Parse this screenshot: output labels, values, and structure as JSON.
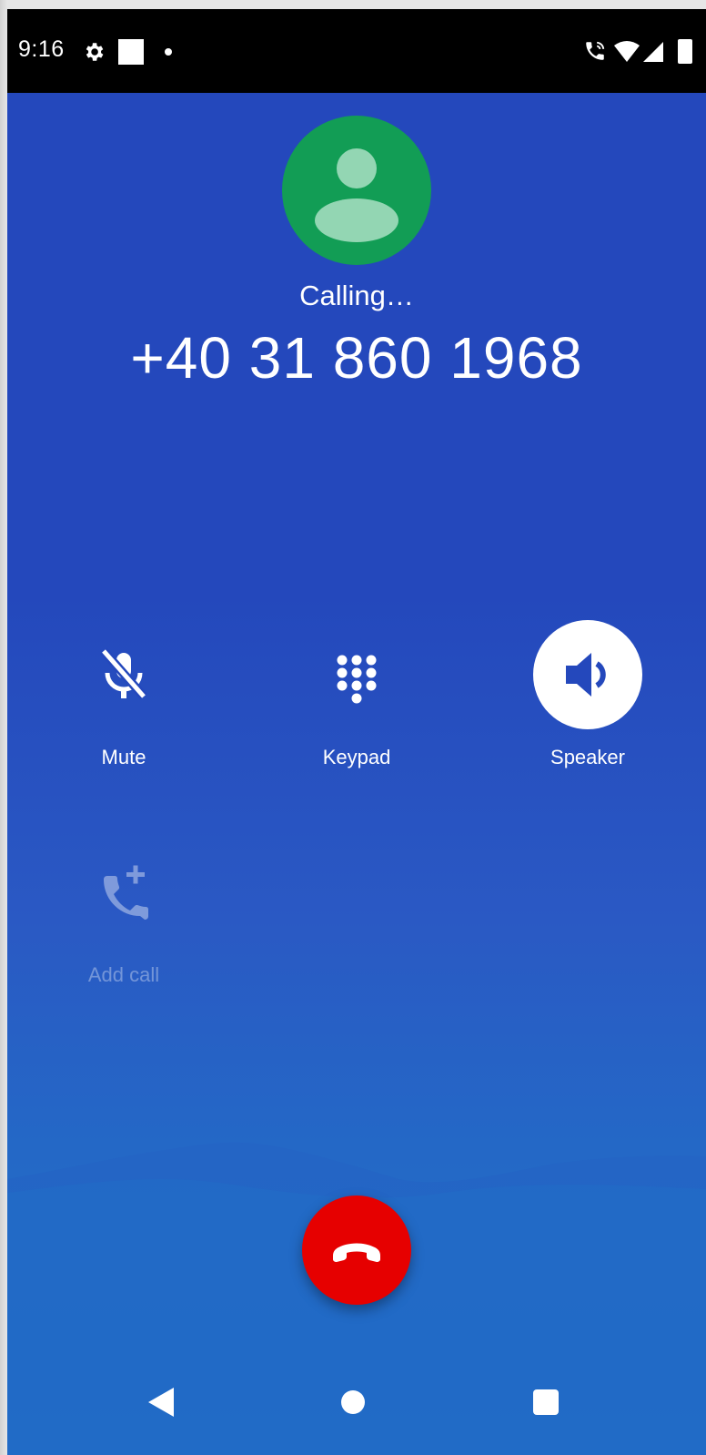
{
  "status_bar": {
    "time": "9:16",
    "icons": [
      "settings-icon",
      "square-notification-icon",
      "dot-icon",
      "wifi-call-icon",
      "wifi-icon",
      "signal-icon",
      "battery-icon"
    ]
  },
  "call": {
    "status": "Calling…",
    "number": "+40 31 860 1968",
    "avatar_color": "#129d55"
  },
  "controls": [
    {
      "id": "mute",
      "label": "Mute",
      "icon": "mic-off-icon",
      "active": false,
      "enabled": true
    },
    {
      "id": "keypad",
      "label": "Keypad",
      "icon": "dialpad-icon",
      "active": false,
      "enabled": true
    },
    {
      "id": "speaker",
      "label": "Speaker",
      "icon": "speaker-icon",
      "active": true,
      "enabled": true
    },
    {
      "id": "add_call",
      "label": "Add call",
      "icon": "add-call-icon",
      "active": false,
      "enabled": false
    }
  ],
  "end_call": {
    "icon": "end-call-icon",
    "color": "#e60000"
  },
  "nav_bar": {
    "icons": [
      "back-icon",
      "home-icon",
      "recents-icon"
    ]
  },
  "colors": {
    "background": "#2448bc",
    "status_bar": "#000000"
  }
}
